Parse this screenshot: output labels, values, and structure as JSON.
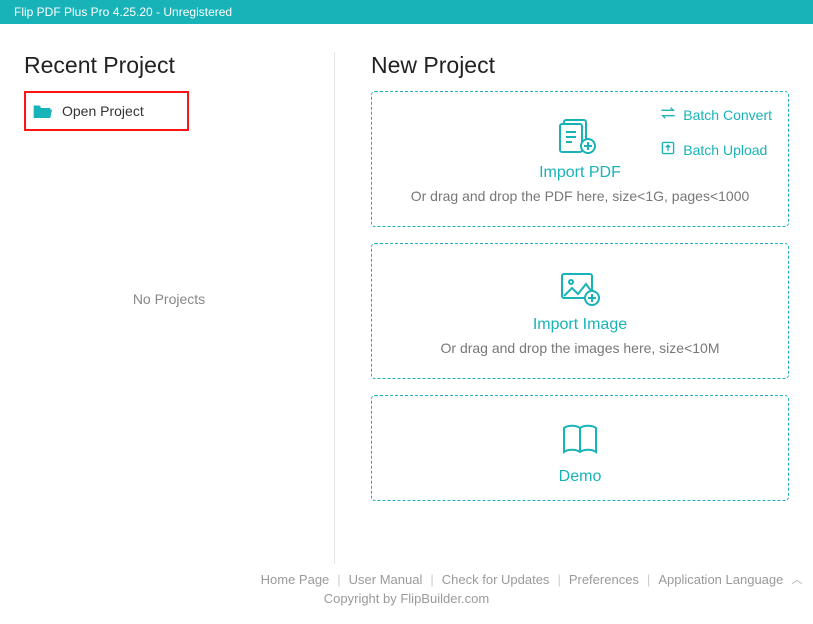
{
  "titlebar": {
    "text": "Flip PDF Plus Pro 4.25.20 - Unregistered"
  },
  "left": {
    "heading": "Recent Project",
    "open_project_label": "Open Project",
    "no_projects": "No Projects"
  },
  "right": {
    "heading": "New Project",
    "import_pdf": {
      "title": "Import PDF",
      "sub": "Or drag and drop the PDF here, size<1G, pages<1000",
      "batch_convert": "Batch Convert",
      "batch_upload": "Batch Upload"
    },
    "import_image": {
      "title": "Import Image",
      "sub": "Or drag and drop the images here, size<10M"
    },
    "demo": {
      "title": "Demo"
    }
  },
  "footer": {
    "home": "Home Page",
    "manual": "User Manual",
    "updates": "Check for Updates",
    "prefs": "Preferences",
    "lang": "Application Language",
    "copyright": "Copyright by FlipBuilder.com"
  }
}
